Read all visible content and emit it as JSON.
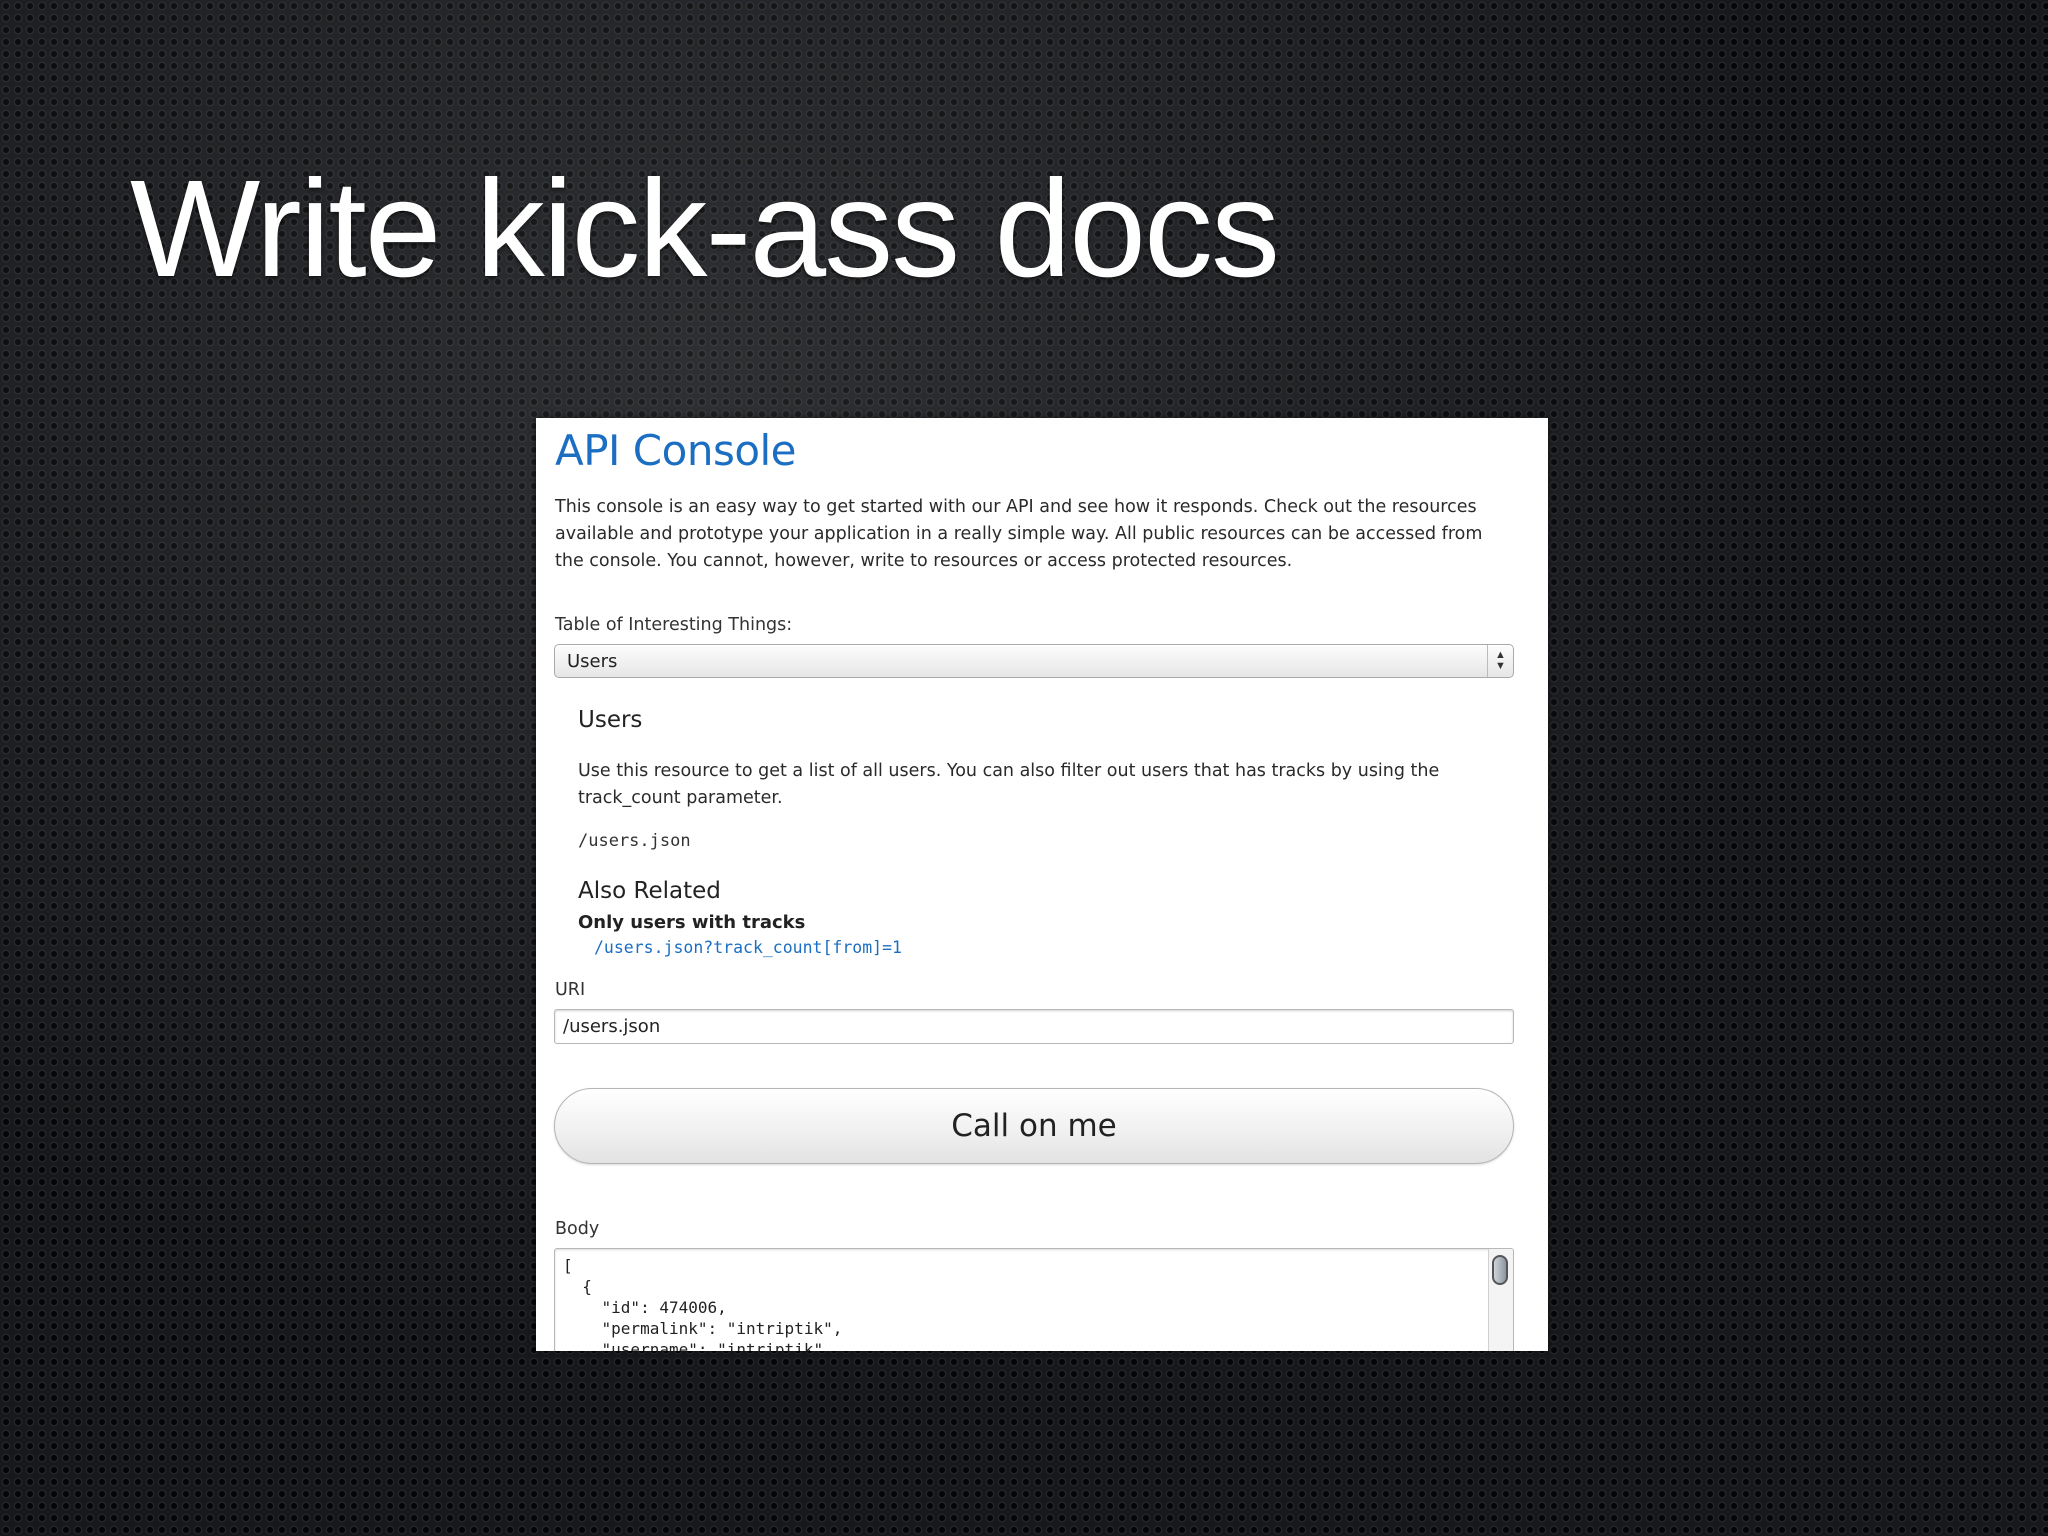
{
  "slide": {
    "title": "Write kick-ass docs"
  },
  "console": {
    "title": "API Console",
    "intro": "This console is an easy way to get started with our API and see how it responds. Check out the resources available and prototype your application in a really simple way. All public resources can be accessed from the console. You cannot, however, write to resources or access protected resources.",
    "table_label": "Table of Interesting Things:",
    "selected_resource": "Users",
    "resource": {
      "heading": "Users",
      "description": "Use this resource to get a list of all users. You can also filter out users that has tracks by using the track_count parameter.",
      "endpoint": "/users.json"
    },
    "also_related": {
      "heading": "Also Related",
      "subheading": "Only users with tracks",
      "link": "/users.json?track_count[from]=1"
    },
    "uri_label": "URI",
    "uri_value": "/users.json",
    "call_button": "Call on me",
    "body_label": "Body",
    "body_text": "[\n  {\n    \"id\": 474006,\n    \"permalink\": \"intriptik\",\n    \"username\": \"intriptik\","
  },
  "colors": {
    "link_blue": "#1b6ec2",
    "slide_background": "#16181b"
  },
  "icons": {
    "select_arrows": "select-updown-icon"
  }
}
